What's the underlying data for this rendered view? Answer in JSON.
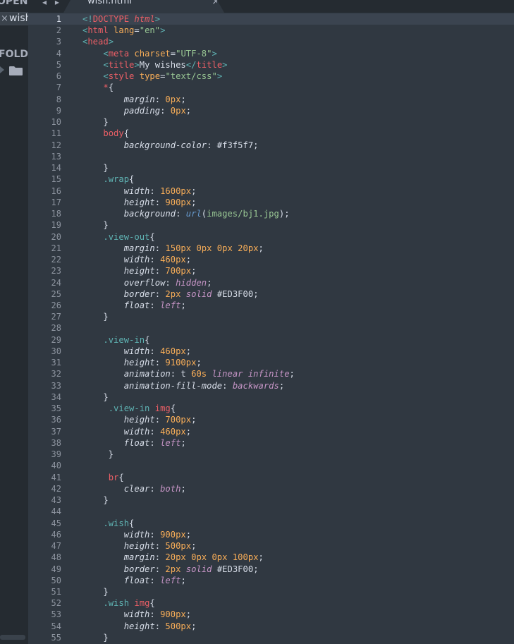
{
  "sidebar": {
    "open_files_label": "OPEN",
    "folders_label": "FOLDERS",
    "open_file": "wish.html",
    "close_glyph": "×",
    "folder_icon": "folder-icon"
  },
  "tab": {
    "label": "wish.html",
    "close_glyph": "×",
    "nav_arrows": "◂ ▸"
  },
  "editor": {
    "current_line": 1,
    "lines": [
      [
        [
          "t-punc",
          "<!"
        ],
        [
          "t-tag",
          "DOCTYPE "
        ],
        [
          "t-dt",
          "html"
        ],
        [
          "t-punc",
          ">"
        ]
      ],
      [
        [
          "t-punc",
          "<"
        ],
        [
          "t-tag",
          "html "
        ],
        [
          "t-attr",
          "lang"
        ],
        [
          "t-text",
          "="
        ],
        [
          "t-str",
          "\"en\""
        ],
        [
          "t-punc",
          ">"
        ]
      ],
      [
        [
          "t-punc",
          "<"
        ],
        [
          "t-tag",
          "head"
        ],
        [
          "t-punc",
          ">"
        ]
      ],
      [
        [
          "t-text",
          "    "
        ],
        [
          "t-punc",
          "<"
        ],
        [
          "t-tag",
          "meta "
        ],
        [
          "t-attr",
          "charset"
        ],
        [
          "t-text",
          "="
        ],
        [
          "t-str",
          "\"UTF-8\""
        ],
        [
          "t-punc",
          ">"
        ]
      ],
      [
        [
          "t-text",
          "    "
        ],
        [
          "t-punc",
          "<"
        ],
        [
          "t-tag",
          "title"
        ],
        [
          "t-punc",
          ">"
        ],
        [
          "t-text",
          "My wishes"
        ],
        [
          "t-punc",
          "</"
        ],
        [
          "t-tag",
          "title"
        ],
        [
          "t-punc",
          ">"
        ]
      ],
      [
        [
          "t-text",
          "    "
        ],
        [
          "t-punc",
          "<"
        ],
        [
          "t-tag",
          "style "
        ],
        [
          "t-attr",
          "type"
        ],
        [
          "t-text",
          "="
        ],
        [
          "t-str",
          "\"text/css\""
        ],
        [
          "t-punc",
          ">"
        ]
      ],
      [
        [
          "t-text",
          "    "
        ],
        [
          "t-sel",
          "*"
        ],
        [
          "t-text",
          "{"
        ]
      ],
      [
        [
          "t-text",
          "        "
        ],
        [
          "t-prop",
          "margin"
        ],
        [
          "t-text",
          ": "
        ],
        [
          "t-num",
          "0px"
        ],
        [
          "t-text",
          ";"
        ]
      ],
      [
        [
          "t-text",
          "        "
        ],
        [
          "t-prop",
          "padding"
        ],
        [
          "t-text",
          ": "
        ],
        [
          "t-num",
          "0px"
        ],
        [
          "t-text",
          ";"
        ]
      ],
      [
        [
          "t-text",
          "    }"
        ]
      ],
      [
        [
          "t-text",
          "    "
        ],
        [
          "t-sel",
          "body"
        ],
        [
          "t-text",
          "{"
        ]
      ],
      [
        [
          "t-text",
          "        "
        ],
        [
          "t-prop",
          "background-color"
        ],
        [
          "t-text",
          ": "
        ],
        [
          "t-hex",
          "#f3f5f7"
        ],
        [
          "t-text",
          ";"
        ]
      ],
      [
        [
          "t-text",
          ""
        ]
      ],
      [
        [
          "t-text",
          "    }"
        ]
      ],
      [
        [
          "t-text",
          "    "
        ],
        [
          "t-cls",
          ".wrap"
        ],
        [
          "t-text",
          "{"
        ]
      ],
      [
        [
          "t-text",
          "        "
        ],
        [
          "t-prop",
          "width"
        ],
        [
          "t-text",
          ": "
        ],
        [
          "t-num",
          "1600px"
        ],
        [
          "t-text",
          ";"
        ]
      ],
      [
        [
          "t-text",
          "        "
        ],
        [
          "t-prop",
          "height"
        ],
        [
          "t-text",
          ": "
        ],
        [
          "t-num",
          "900px"
        ],
        [
          "t-text",
          ";"
        ]
      ],
      [
        [
          "t-text",
          "        "
        ],
        [
          "t-prop",
          "background"
        ],
        [
          "t-text",
          ": "
        ],
        [
          "t-fn",
          "url"
        ],
        [
          "t-text",
          "("
        ],
        [
          "t-str",
          "images/bj1.jpg"
        ],
        [
          "t-text",
          ");"
        ]
      ],
      [
        [
          "t-text",
          "    }"
        ]
      ],
      [
        [
          "t-text",
          "    "
        ],
        [
          "t-cls",
          ".view-out"
        ],
        [
          "t-text",
          "{"
        ]
      ],
      [
        [
          "t-text",
          "        "
        ],
        [
          "t-prop",
          "margin"
        ],
        [
          "t-text",
          ": "
        ],
        [
          "t-num",
          "150px 0px 0px 20px"
        ],
        [
          "t-text",
          ";"
        ]
      ],
      [
        [
          "t-text",
          "        "
        ],
        [
          "t-prop",
          "width"
        ],
        [
          "t-text",
          ": "
        ],
        [
          "t-num",
          "460px"
        ],
        [
          "t-text",
          ";"
        ]
      ],
      [
        [
          "t-text",
          "        "
        ],
        [
          "t-prop",
          "height"
        ],
        [
          "t-text",
          ": "
        ],
        [
          "t-num",
          "700px"
        ],
        [
          "t-text",
          ";"
        ]
      ],
      [
        [
          "t-text",
          "        "
        ],
        [
          "t-prop",
          "overflow"
        ],
        [
          "t-text",
          ": "
        ],
        [
          "t-kw",
          "hidden"
        ],
        [
          "t-text",
          ";"
        ]
      ],
      [
        [
          "t-text",
          "        "
        ],
        [
          "t-prop",
          "border"
        ],
        [
          "t-text",
          ": "
        ],
        [
          "t-num",
          "2px "
        ],
        [
          "t-kw",
          "solid"
        ],
        [
          "t-text",
          " "
        ],
        [
          "t-hex",
          "#ED3F00"
        ],
        [
          "t-text",
          ";"
        ]
      ],
      [
        [
          "t-text",
          "        "
        ],
        [
          "t-prop",
          "float"
        ],
        [
          "t-text",
          ": "
        ],
        [
          "t-kw",
          "left"
        ],
        [
          "t-text",
          ";"
        ]
      ],
      [
        [
          "t-text",
          "    }"
        ]
      ],
      [
        [
          "t-text",
          ""
        ]
      ],
      [
        [
          "t-text",
          "    "
        ],
        [
          "t-cls",
          ".view-in"
        ],
        [
          "t-text",
          "{"
        ]
      ],
      [
        [
          "t-text",
          "        "
        ],
        [
          "t-prop",
          "width"
        ],
        [
          "t-text",
          ": "
        ],
        [
          "t-num",
          "460px"
        ],
        [
          "t-text",
          ";"
        ]
      ],
      [
        [
          "t-text",
          "        "
        ],
        [
          "t-prop",
          "height"
        ],
        [
          "t-text",
          ": "
        ],
        [
          "t-num",
          "9100px"
        ],
        [
          "t-text",
          ";"
        ]
      ],
      [
        [
          "t-text",
          "        "
        ],
        [
          "t-prop",
          "animation"
        ],
        [
          "t-text",
          ": t "
        ],
        [
          "t-num",
          "60s "
        ],
        [
          "t-kw",
          "linear infinite"
        ],
        [
          "t-text",
          ";"
        ]
      ],
      [
        [
          "t-text",
          "        "
        ],
        [
          "t-prop",
          "animation-fill-mode"
        ],
        [
          "t-text",
          ": "
        ],
        [
          "t-kw",
          "backwards"
        ],
        [
          "t-text",
          ";"
        ]
      ],
      [
        [
          "t-text",
          "    }"
        ]
      ],
      [
        [
          "t-text",
          "     "
        ],
        [
          "t-cls",
          ".view-in "
        ],
        [
          "t-sel",
          "img"
        ],
        [
          "t-text",
          "{"
        ]
      ],
      [
        [
          "t-text",
          "        "
        ],
        [
          "t-prop",
          "height"
        ],
        [
          "t-text",
          ": "
        ],
        [
          "t-num",
          "700px"
        ],
        [
          "t-text",
          ";"
        ]
      ],
      [
        [
          "t-text",
          "        "
        ],
        [
          "t-prop",
          "width"
        ],
        [
          "t-text",
          ": "
        ],
        [
          "t-num",
          "460px"
        ],
        [
          "t-text",
          ";"
        ]
      ],
      [
        [
          "t-text",
          "        "
        ],
        [
          "t-prop",
          "float"
        ],
        [
          "t-text",
          ": "
        ],
        [
          "t-kw",
          "left"
        ],
        [
          "t-text",
          ";"
        ]
      ],
      [
        [
          "t-text",
          "     }"
        ]
      ],
      [
        [
          "t-text",
          ""
        ]
      ],
      [
        [
          "t-text",
          "     "
        ],
        [
          "t-sel",
          "br"
        ],
        [
          "t-text",
          "{"
        ]
      ],
      [
        [
          "t-text",
          "        "
        ],
        [
          "t-prop",
          "clear"
        ],
        [
          "t-text",
          ": "
        ],
        [
          "t-kw",
          "both"
        ],
        [
          "t-text",
          ";"
        ]
      ],
      [
        [
          "t-text",
          "    }"
        ]
      ],
      [
        [
          "t-text",
          ""
        ]
      ],
      [
        [
          "t-text",
          "    "
        ],
        [
          "t-cls",
          ".wish"
        ],
        [
          "t-text",
          "{"
        ]
      ],
      [
        [
          "t-text",
          "        "
        ],
        [
          "t-prop",
          "width"
        ],
        [
          "t-text",
          ": "
        ],
        [
          "t-num",
          "900px"
        ],
        [
          "t-text",
          ";"
        ]
      ],
      [
        [
          "t-text",
          "        "
        ],
        [
          "t-prop",
          "height"
        ],
        [
          "t-text",
          ": "
        ],
        [
          "t-num",
          "500px"
        ],
        [
          "t-text",
          ";"
        ]
      ],
      [
        [
          "t-text",
          "        "
        ],
        [
          "t-prop",
          "margin"
        ],
        [
          "t-text",
          ": "
        ],
        [
          "t-num",
          "20px 0px 0px 100px"
        ],
        [
          "t-text",
          ";"
        ]
      ],
      [
        [
          "t-text",
          "        "
        ],
        [
          "t-prop",
          "border"
        ],
        [
          "t-text",
          ": "
        ],
        [
          "t-num",
          "2px "
        ],
        [
          "t-kw",
          "solid"
        ],
        [
          "t-text",
          " "
        ],
        [
          "t-hex",
          "#ED3F00"
        ],
        [
          "t-text",
          ";"
        ]
      ],
      [
        [
          "t-text",
          "        "
        ],
        [
          "t-prop",
          "float"
        ],
        [
          "t-text",
          ": "
        ],
        [
          "t-kw",
          "left"
        ],
        [
          "t-text",
          ";"
        ]
      ],
      [
        [
          "t-text",
          "    }"
        ]
      ],
      [
        [
          "t-text",
          "    "
        ],
        [
          "t-cls",
          ".wish "
        ],
        [
          "t-sel",
          "img"
        ],
        [
          "t-text",
          "{"
        ]
      ],
      [
        [
          "t-text",
          "        "
        ],
        [
          "t-prop",
          "width"
        ],
        [
          "t-text",
          ": "
        ],
        [
          "t-num",
          "900px"
        ],
        [
          "t-text",
          ";"
        ]
      ],
      [
        [
          "t-text",
          "        "
        ],
        [
          "t-prop",
          "height"
        ],
        [
          "t-text",
          ": "
        ],
        [
          "t-num",
          "500px"
        ],
        [
          "t-text",
          ";"
        ]
      ],
      [
        [
          "t-text",
          "    }"
        ]
      ]
    ]
  },
  "colors": {
    "background": "#303841",
    "sidebar": "#252b31",
    "current_line": "#3b4450",
    "tag": "#ec5f66",
    "attribute": "#f9ae58",
    "string": "#99c794",
    "keyword": "#c695c6",
    "function": "#6699cc"
  }
}
